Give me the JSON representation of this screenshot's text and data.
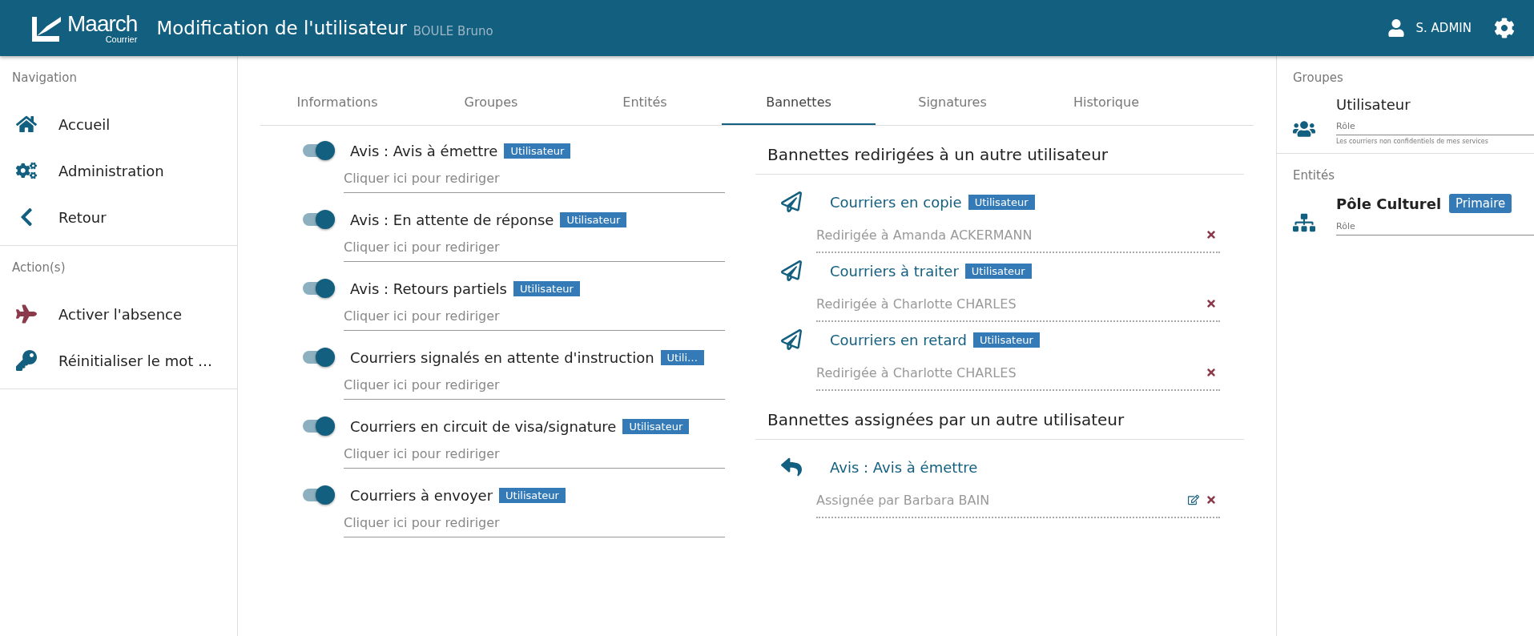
{
  "header": {
    "logo": {
      "name": "Maarch",
      "sub": "Courrier"
    },
    "title": "Modification de l'utilisateur",
    "subtitle": "BOULE Bruno",
    "user": "S. ADMIN"
  },
  "sidebar": {
    "sections": [
      {
        "title": "Navigation",
        "items": [
          {
            "label": "Accueil",
            "kind": "home"
          },
          {
            "label": "Administration",
            "kind": "admin"
          },
          {
            "label": "Retour",
            "kind": "back"
          }
        ]
      },
      {
        "title": "Action(s)",
        "items": [
          {
            "label": "Activer l'absence",
            "kind": "absence"
          },
          {
            "label": "Réinitialiser le mot …",
            "kind": "password"
          }
        ]
      }
    ]
  },
  "tabs": [
    {
      "label": "Informations",
      "selected": false
    },
    {
      "label": "Groupes",
      "selected": false
    },
    {
      "label": "Entités",
      "selected": false
    },
    {
      "label": "Bannettes",
      "selected": true
    },
    {
      "label": "Signatures",
      "selected": false
    },
    {
      "label": "Historique",
      "selected": false
    }
  ],
  "baskets": [
    {
      "label": "Avis : Avis à émettre",
      "badge": "Utilisateur",
      "on": true,
      "placeholder": "Cliquer ici pour rediriger"
    },
    {
      "label": "Avis : En attente de réponse",
      "badge": "Utilisateur",
      "on": true,
      "placeholder": "Cliquer ici pour rediriger"
    },
    {
      "label": "Avis : Retours partiels",
      "badge": "Utilisateur",
      "on": true,
      "placeholder": "Cliquer ici pour rediriger"
    },
    {
      "label": "Courriers signalés en attente d'instruction",
      "badge": "Utili…",
      "on": true,
      "placeholder": "Cliquer ici pour rediriger"
    },
    {
      "label": "Courriers en circuit de visa/signature",
      "badge": "Utilisateur",
      "on": true,
      "placeholder": "Cliquer ici pour rediriger"
    },
    {
      "label": "Courriers à envoyer",
      "badge": "Utilisateur",
      "on": true,
      "placeholder": "Cliquer ici pour rediriger"
    }
  ],
  "redirected": {
    "title": "Bannettes redirigées à un autre utilisateur",
    "items": [
      {
        "label": "Courriers en copie",
        "badge": "Utilisateur",
        "value": "Redirigée à Amanda ACKERMANN",
        "editable": false
      },
      {
        "label": "Courriers à traiter",
        "badge": "Utilisateur",
        "value": "Redirigée à Charlotte CHARLES",
        "editable": false
      },
      {
        "label": "Courriers en retard",
        "badge": "Utilisateur",
        "value": "Redirigée à Charlotte CHARLES",
        "editable": false
      }
    ]
  },
  "assigned": {
    "title": "Bannettes assignées par un autre utilisateur",
    "items": [
      {
        "label": "Avis : Avis à émettre",
        "value": "Assignée par Barbara BAIN",
        "editable": true
      }
    ]
  },
  "right_panel": {
    "groups_title": "Groupes",
    "groups": [
      {
        "label": "Utilisateur",
        "role_placeholder": "Rôle",
        "hint": "Les courriers non confidentiels de mes services"
      }
    ],
    "entities_title": "Entités",
    "entities": [
      {
        "label": "Pôle Culturel",
        "badge": "Primaire",
        "role_placeholder": "Rôle"
      }
    ]
  }
}
